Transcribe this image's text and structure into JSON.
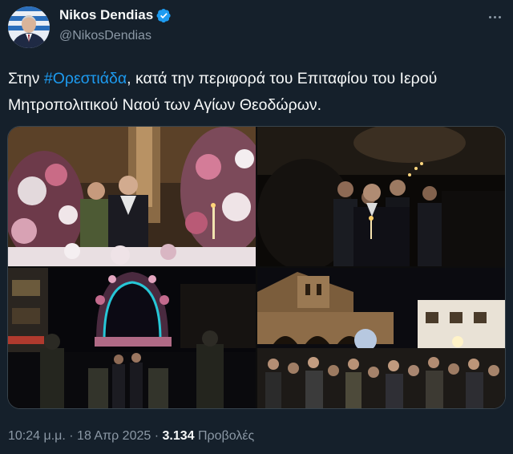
{
  "author": {
    "name": "Nikos Dendias",
    "handle": "@NikosDendias",
    "avatar_icon": "profile-photo",
    "verified_icon": "verified-badge-icon",
    "verified_color": "#1d9bf0"
  },
  "tweet": {
    "text_before": "Στην ",
    "hashtag": "#Ορεστιάδα",
    "text_after": ", κατά την περιφορά του Επιταφίου του Ιερού Μητροπολιτικού Ναού των Αγίων Θεοδώρων."
  },
  "media": {
    "photos": [
      {
        "subject": "procession-at-flowered-epitaph"
      },
      {
        "subject": "candlelit-crowd-at-night"
      },
      {
        "subject": "illuminated-epitaph-in-street"
      },
      {
        "subject": "crowd-outside-church"
      }
    ]
  },
  "footer": {
    "time": "10:24 μ.μ.",
    "separator": "·",
    "date": "18 Απρ 2025",
    "views_count": "3.134",
    "views_label": "Προβολές"
  },
  "colors": {
    "background": "#15202b",
    "text": "#f7f9f9",
    "secondary": "#8b98a5",
    "link": "#1d9bf0",
    "border": "#38444d"
  }
}
